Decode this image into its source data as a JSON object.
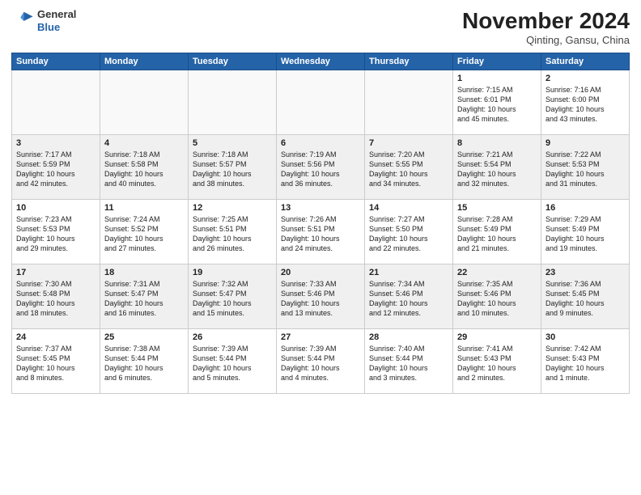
{
  "header": {
    "logo": {
      "general": "General",
      "blue": "Blue"
    },
    "month": "November 2024",
    "location": "Qinting, Gansu, China"
  },
  "weekdays": [
    "Sunday",
    "Monday",
    "Tuesday",
    "Wednesday",
    "Thursday",
    "Friday",
    "Saturday"
  ],
  "weeks": [
    [
      {
        "day": "",
        "info": ""
      },
      {
        "day": "",
        "info": ""
      },
      {
        "day": "",
        "info": ""
      },
      {
        "day": "",
        "info": ""
      },
      {
        "day": "",
        "info": ""
      },
      {
        "day": "1",
        "info": "Sunrise: 7:15 AM\nSunset: 6:01 PM\nDaylight: 10 hours\nand 45 minutes."
      },
      {
        "day": "2",
        "info": "Sunrise: 7:16 AM\nSunset: 6:00 PM\nDaylight: 10 hours\nand 43 minutes."
      }
    ],
    [
      {
        "day": "3",
        "info": "Sunrise: 7:17 AM\nSunset: 5:59 PM\nDaylight: 10 hours\nand 42 minutes."
      },
      {
        "day": "4",
        "info": "Sunrise: 7:18 AM\nSunset: 5:58 PM\nDaylight: 10 hours\nand 40 minutes."
      },
      {
        "day": "5",
        "info": "Sunrise: 7:18 AM\nSunset: 5:57 PM\nDaylight: 10 hours\nand 38 minutes."
      },
      {
        "day": "6",
        "info": "Sunrise: 7:19 AM\nSunset: 5:56 PM\nDaylight: 10 hours\nand 36 minutes."
      },
      {
        "day": "7",
        "info": "Sunrise: 7:20 AM\nSunset: 5:55 PM\nDaylight: 10 hours\nand 34 minutes."
      },
      {
        "day": "8",
        "info": "Sunrise: 7:21 AM\nSunset: 5:54 PM\nDaylight: 10 hours\nand 32 minutes."
      },
      {
        "day": "9",
        "info": "Sunrise: 7:22 AM\nSunset: 5:53 PM\nDaylight: 10 hours\nand 31 minutes."
      }
    ],
    [
      {
        "day": "10",
        "info": "Sunrise: 7:23 AM\nSunset: 5:53 PM\nDaylight: 10 hours\nand 29 minutes."
      },
      {
        "day": "11",
        "info": "Sunrise: 7:24 AM\nSunset: 5:52 PM\nDaylight: 10 hours\nand 27 minutes."
      },
      {
        "day": "12",
        "info": "Sunrise: 7:25 AM\nSunset: 5:51 PM\nDaylight: 10 hours\nand 26 minutes."
      },
      {
        "day": "13",
        "info": "Sunrise: 7:26 AM\nSunset: 5:51 PM\nDaylight: 10 hours\nand 24 minutes."
      },
      {
        "day": "14",
        "info": "Sunrise: 7:27 AM\nSunset: 5:50 PM\nDaylight: 10 hours\nand 22 minutes."
      },
      {
        "day": "15",
        "info": "Sunrise: 7:28 AM\nSunset: 5:49 PM\nDaylight: 10 hours\nand 21 minutes."
      },
      {
        "day": "16",
        "info": "Sunrise: 7:29 AM\nSunset: 5:49 PM\nDaylight: 10 hours\nand 19 minutes."
      }
    ],
    [
      {
        "day": "17",
        "info": "Sunrise: 7:30 AM\nSunset: 5:48 PM\nDaylight: 10 hours\nand 18 minutes."
      },
      {
        "day": "18",
        "info": "Sunrise: 7:31 AM\nSunset: 5:47 PM\nDaylight: 10 hours\nand 16 minutes."
      },
      {
        "day": "19",
        "info": "Sunrise: 7:32 AM\nSunset: 5:47 PM\nDaylight: 10 hours\nand 15 minutes."
      },
      {
        "day": "20",
        "info": "Sunrise: 7:33 AM\nSunset: 5:46 PM\nDaylight: 10 hours\nand 13 minutes."
      },
      {
        "day": "21",
        "info": "Sunrise: 7:34 AM\nSunset: 5:46 PM\nDaylight: 10 hours\nand 12 minutes."
      },
      {
        "day": "22",
        "info": "Sunrise: 7:35 AM\nSunset: 5:46 PM\nDaylight: 10 hours\nand 10 minutes."
      },
      {
        "day": "23",
        "info": "Sunrise: 7:36 AM\nSunset: 5:45 PM\nDaylight: 10 hours\nand 9 minutes."
      }
    ],
    [
      {
        "day": "24",
        "info": "Sunrise: 7:37 AM\nSunset: 5:45 PM\nDaylight: 10 hours\nand 8 minutes."
      },
      {
        "day": "25",
        "info": "Sunrise: 7:38 AM\nSunset: 5:44 PM\nDaylight: 10 hours\nand 6 minutes."
      },
      {
        "day": "26",
        "info": "Sunrise: 7:39 AM\nSunset: 5:44 PM\nDaylight: 10 hours\nand 5 minutes."
      },
      {
        "day": "27",
        "info": "Sunrise: 7:39 AM\nSunset: 5:44 PM\nDaylight: 10 hours\nand 4 minutes."
      },
      {
        "day": "28",
        "info": "Sunrise: 7:40 AM\nSunset: 5:44 PM\nDaylight: 10 hours\nand 3 minutes."
      },
      {
        "day": "29",
        "info": "Sunrise: 7:41 AM\nSunset: 5:43 PM\nDaylight: 10 hours\nand 2 minutes."
      },
      {
        "day": "30",
        "info": "Sunrise: 7:42 AM\nSunset: 5:43 PM\nDaylight: 10 hours\nand 1 minute."
      }
    ]
  ]
}
